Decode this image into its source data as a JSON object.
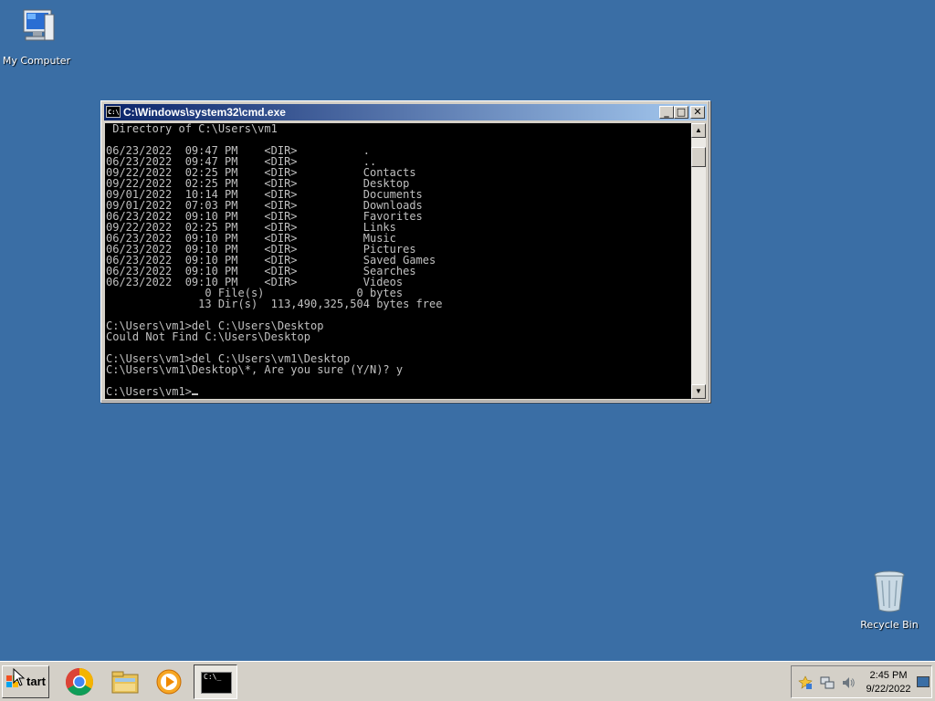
{
  "desktop": {
    "icons": [
      {
        "label": "My Computer",
        "icon": "computer-icon"
      },
      {
        "label": "Recycle Bin",
        "icon": "recycle-bin-icon"
      }
    ]
  },
  "cmd_window": {
    "title": "C:\\Windows\\system32\\cmd.exe",
    "icon_text": "C:\\",
    "buttons": {
      "minimize": "_",
      "maximize": "□",
      "close": "✕"
    },
    "lines": [
      " Directory of C:\\Users\\vm1",
      "",
      "06/23/2022  09:47 PM    <DIR>          .",
      "06/23/2022  09:47 PM    <DIR>          ..",
      "09/22/2022  02:25 PM    <DIR>          Contacts",
      "09/22/2022  02:25 PM    <DIR>          Desktop",
      "09/01/2022  10:14 PM    <DIR>          Documents",
      "09/01/2022  07:03 PM    <DIR>          Downloads",
      "06/23/2022  09:10 PM    <DIR>          Favorites",
      "09/22/2022  02:25 PM    <DIR>          Links",
      "06/23/2022  09:10 PM    <DIR>          Music",
      "06/23/2022  09:10 PM    <DIR>          Pictures",
      "06/23/2022  09:10 PM    <DIR>          Saved Games",
      "06/23/2022  09:10 PM    <DIR>          Searches",
      "06/23/2022  09:10 PM    <DIR>          Videos",
      "               0 File(s)              0 bytes",
      "              13 Dir(s)  113,490,325,504 bytes free",
      "",
      "C:\\Users\\vm1>del C:\\Users\\Desktop",
      "Could Not Find C:\\Users\\Desktop",
      "",
      "C:\\Users\\vm1>del C:\\Users\\vm1\\Desktop",
      "C:\\Users\\vm1\\Desktop\\*, Are you sure (Y/N)? y",
      ""
    ],
    "prompt": "C:\\Users\\vm1>",
    "scroll": {
      "up": "▲",
      "down": "▼"
    }
  },
  "taskbar": {
    "start_label": "Start",
    "start_visible_label": "tart",
    "apps": [
      {
        "icon": "chrome-icon"
      },
      {
        "icon": "file-explorer-icon"
      },
      {
        "icon": "media-player-icon"
      },
      {
        "icon": "cmd-icon",
        "icon_text": "C:\\_"
      }
    ],
    "tray": {
      "icons": [
        "action-center-icon",
        "network-icon",
        "volume-icon"
      ],
      "time": "2:45 PM",
      "date": "9/22/2022"
    }
  },
  "colors": {
    "desktop": "#3a6ea5",
    "titlebar_start": "#0a246a",
    "titlebar_end": "#a6caf0",
    "console_bg": "#000000",
    "console_fg": "#c0c0c0"
  }
}
